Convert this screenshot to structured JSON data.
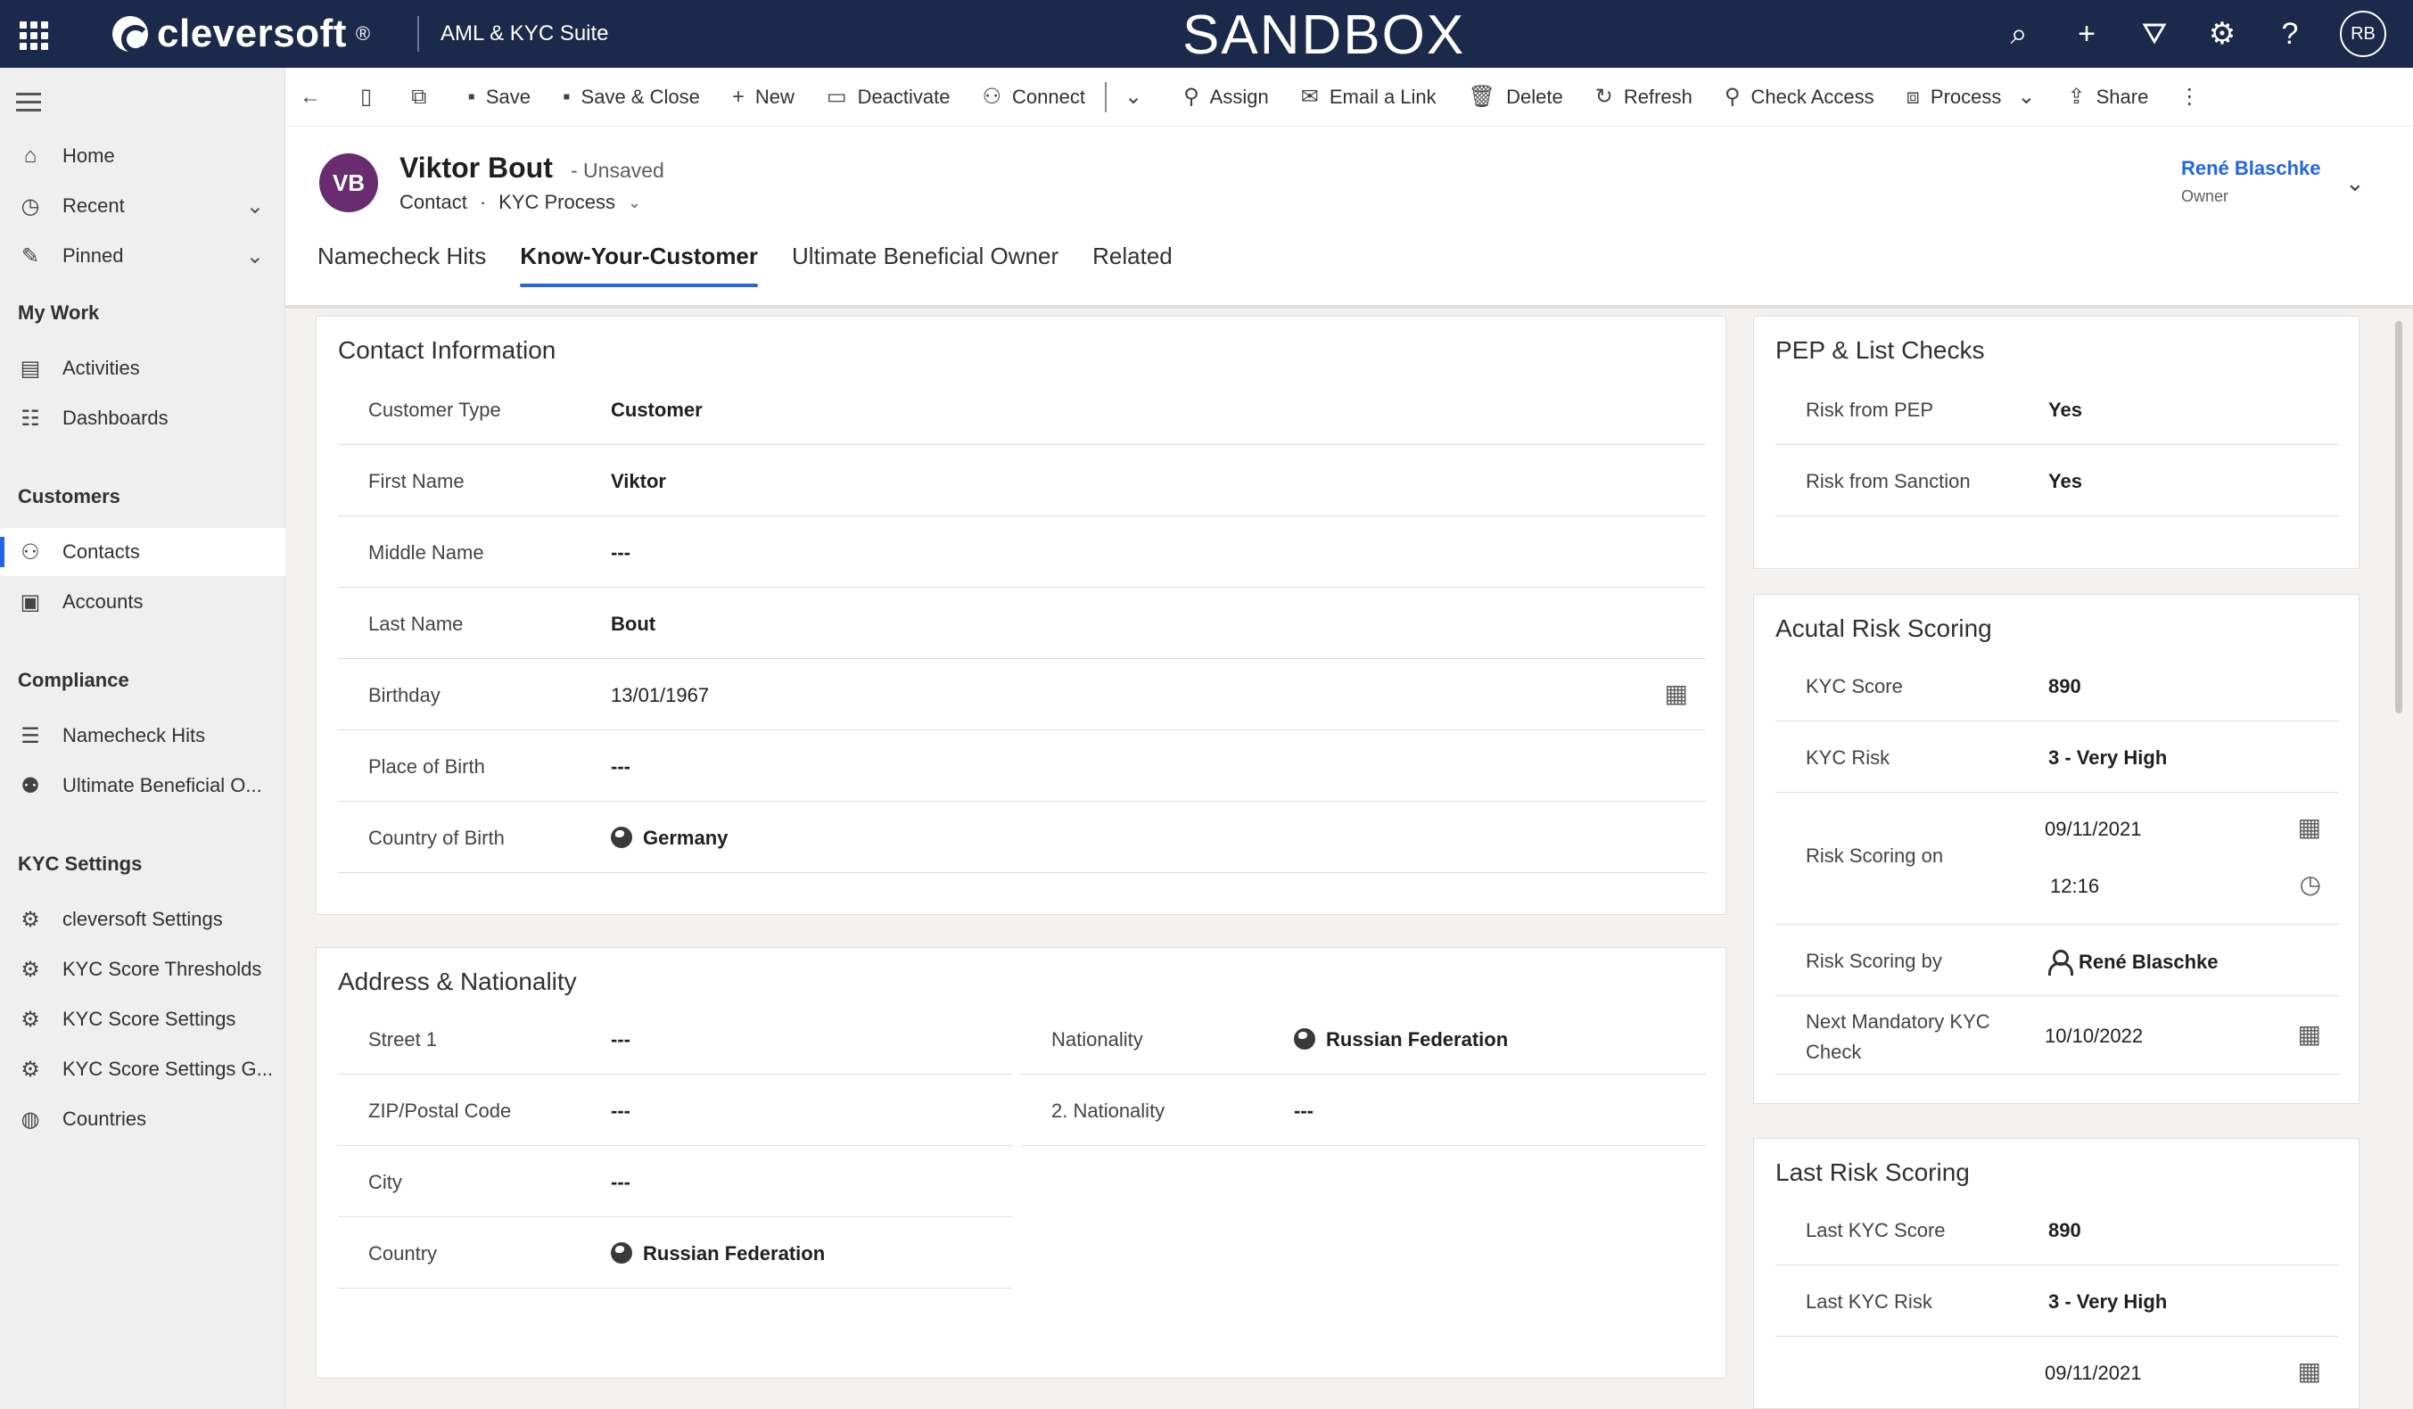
{
  "topbar": {
    "brand": "cleversoft",
    "brand_mark": "®",
    "app_name": "AML & KYC Suite",
    "environment": "SANDBOX",
    "user_initials": "RB",
    "icons": [
      "search-icon",
      "add-icon",
      "filter-icon",
      "settings-icon",
      "help-icon"
    ]
  },
  "nav": {
    "items_top": [
      {
        "label": "Home",
        "icon": "home-icon"
      },
      {
        "label": "Recent",
        "icon": "clock-icon"
      },
      {
        "label": "Pinned",
        "icon": "pin-icon"
      }
    ],
    "groups": [
      {
        "title": "My Work",
        "items": [
          "Activities",
          "Dashboards"
        ]
      },
      {
        "title": "Customers",
        "items": [
          "Contacts",
          "Accounts"
        ]
      },
      {
        "title": "Compliance",
        "items": [
          "Namecheck Hits",
          "Ultimate Beneficial O..."
        ]
      },
      {
        "title": "KYC Settings",
        "items": [
          "cleversoft Settings",
          "KYC Score Thresholds",
          "KYC Score Settings",
          "KYC Score Settings G...",
          "Countries"
        ]
      }
    ],
    "active": "Contacts"
  },
  "commands": [
    "Save",
    "Save & Close",
    "New",
    "Deactivate",
    "Connect",
    "Assign",
    "Email a Link",
    "Delete",
    "Refresh",
    "Check Access",
    "Process",
    "Share"
  ],
  "record": {
    "initials": "VB",
    "name": "Viktor Bout",
    "status": "- Unsaved",
    "entity": "Contact",
    "dot": "·",
    "form": "KYC Process",
    "owner_name": "René Blaschke",
    "owner_label": "Owner"
  },
  "tabs": [
    "Namecheck Hits",
    "Know-Your-Customer",
    "Ultimate Beneficial Owner",
    "Related"
  ],
  "active_tab": "Know-Your-Customer",
  "contact_info": {
    "title": "Contact Information",
    "fields": [
      {
        "label": "Customer Type",
        "value": "Customer"
      },
      {
        "label": "First Name",
        "value": "Viktor"
      },
      {
        "label": "Middle Name",
        "value": "---"
      },
      {
        "label": "Last Name",
        "value": "Bout"
      },
      {
        "label": "Birthday",
        "value": "13/01/1967"
      },
      {
        "label": "Place of Birth",
        "value": "---"
      },
      {
        "label": "Country of Birth",
        "value": "Germany"
      }
    ]
  },
  "address": {
    "title": "Address & Nationality",
    "left": [
      {
        "label": "Street 1",
        "value": "---"
      },
      {
        "label": "ZIP/Postal Code",
        "value": "---"
      },
      {
        "label": "City",
        "value": "---"
      },
      {
        "label": "Country",
        "value": "Russian Federation"
      }
    ],
    "right": [
      {
        "label": "Nationality",
        "value": "Russian Federation"
      },
      {
        "label": "2. Nationality",
        "value": "---"
      }
    ]
  },
  "pep": {
    "title": "PEP & List Checks",
    "fields": [
      {
        "label": "Risk from PEP",
        "value": "Yes"
      },
      {
        "label": "Risk from Sanction",
        "value": "Yes"
      }
    ]
  },
  "actual_risk": {
    "title": "Acutal Risk Scoring",
    "kyc_score_label": "KYC Score",
    "kyc_score": "890",
    "kyc_risk_label": "KYC Risk",
    "kyc_risk": "3 - Very High",
    "scoring_on_label": "Risk Scoring on",
    "scoring_on_date": "09/11/2021",
    "scoring_on_time": "12:16",
    "scoring_by_label": "Risk Scoring by",
    "scoring_by": "René Blaschke",
    "next_check_label": "Next Mandatory KYC Check",
    "next_check": "10/10/2022"
  },
  "last_risk": {
    "title": "Last Risk Scoring",
    "last_score_label": "Last KYC Score",
    "last_score": "890",
    "last_risk_label": "Last KYC Risk",
    "last_risk": "3 - Very High",
    "last_date": "09/11/2021"
  }
}
